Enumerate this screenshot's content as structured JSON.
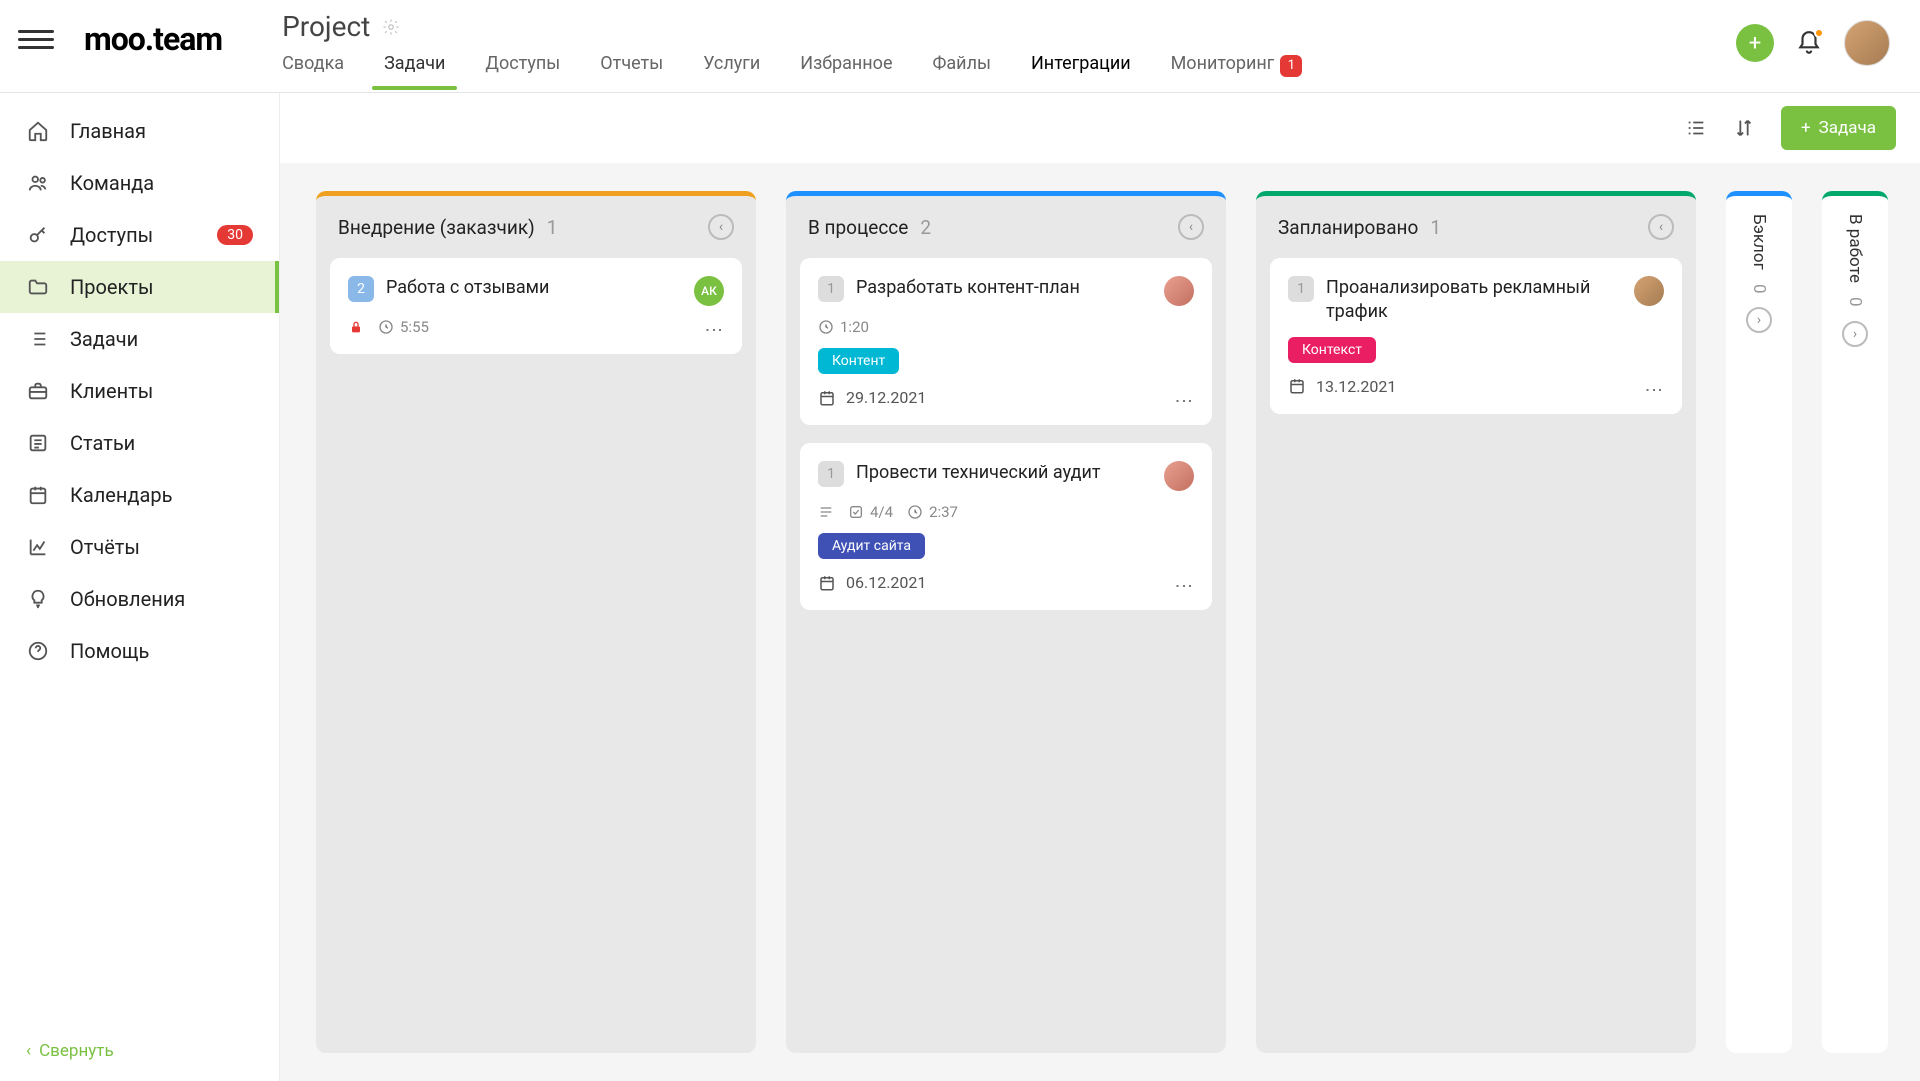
{
  "header": {
    "logo": "moo.team",
    "project_title": "Project",
    "tabs": [
      {
        "label": "Сводка"
      },
      {
        "label": "Задачи",
        "active": true
      },
      {
        "label": "Доступы"
      },
      {
        "label": "Отчеты"
      },
      {
        "label": "Услуги"
      },
      {
        "label": "Избранное"
      },
      {
        "label": "Файлы"
      },
      {
        "label": "Интеграции",
        "dark": true
      },
      {
        "label": "Мониторинг",
        "badge": "1"
      }
    ]
  },
  "sidebar": {
    "items": [
      {
        "label": "Главная",
        "icon": "home"
      },
      {
        "label": "Команда",
        "icon": "users"
      },
      {
        "label": "Доступы",
        "icon": "key",
        "badge": "30"
      },
      {
        "label": "Проекты",
        "icon": "folder",
        "active": true
      },
      {
        "label": "Задачи",
        "icon": "list"
      },
      {
        "label": "Клиенты",
        "icon": "briefcase"
      },
      {
        "label": "Статьи",
        "icon": "article"
      },
      {
        "label": "Календарь",
        "icon": "calendar"
      },
      {
        "label": "Отчёты",
        "icon": "chart"
      },
      {
        "label": "Обновления",
        "icon": "bulb"
      },
      {
        "label": "Помощь",
        "icon": "help"
      }
    ],
    "collapse": "Свернуть"
  },
  "toolbar": {
    "add_task": "Задача"
  },
  "board": {
    "columns": [
      {
        "title": "Внедрение (заказчик)",
        "count": "1",
        "accent": "orange",
        "cards": [
          {
            "num": "2",
            "num_style": "blue",
            "title": "Работа с отзывами",
            "avatar_label": "АК",
            "avatar_style": "green",
            "lock": true,
            "time": "5:55"
          }
        ]
      },
      {
        "title": "В процессе",
        "count": "2",
        "accent": "blue",
        "cards": [
          {
            "num": "1",
            "num_style": "gray",
            "title": "Разработать контент-план",
            "avatar_style": "pink",
            "time": "1:20",
            "tag": {
              "text": "Контент",
              "style": "cyan"
            },
            "date": "29.12.2021"
          },
          {
            "num": "1",
            "num_style": "gray",
            "title": "Провести технический аудит",
            "avatar_style": "pink",
            "desc_icon": true,
            "checklist": "4/4",
            "time": "2:37",
            "tag": {
              "text": "Аудит сайта",
              "style": "indigo"
            },
            "date": "06.12.2021"
          }
        ]
      },
      {
        "title": "Запланировано",
        "count": "1",
        "accent": "green",
        "cards": [
          {
            "num": "1",
            "num_style": "gray",
            "title": "Проанализировать рекламный трафик",
            "avatar_style": "tan",
            "tag": {
              "text": "Контекст",
              "style": "pink"
            },
            "date": "13.12.2021"
          }
        ]
      }
    ],
    "collapsed": [
      {
        "title": "Бэклог",
        "count": "0",
        "accent": "blue"
      },
      {
        "title": "В работе",
        "count": "0",
        "accent": "green"
      }
    ]
  }
}
